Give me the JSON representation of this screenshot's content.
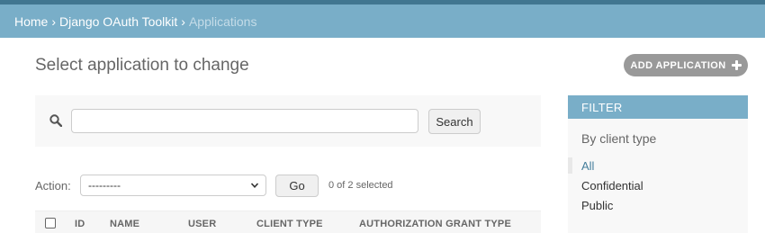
{
  "breadcrumbs": {
    "home": "Home",
    "app": "Django OAuth Toolkit",
    "current": "Applications",
    "separator": "›"
  },
  "page": {
    "title": "Select application to change",
    "add_button_label": "ADD APPLICATION"
  },
  "search": {
    "value": "",
    "button_label": "Search"
  },
  "actions": {
    "label": "Action:",
    "selected_option": "---------",
    "go_label": "Go",
    "selected_count": "0 of 2 selected"
  },
  "table": {
    "columns": [
      "ID",
      "NAME",
      "USER",
      "CLIENT TYPE",
      "AUTHORIZATION GRANT TYPE"
    ]
  },
  "filter": {
    "title": "FILTER",
    "subtitle": "By client type",
    "options": [
      "All",
      "Confidential",
      "Public"
    ],
    "selected": "All"
  },
  "colors": {
    "header_dark": "#417690",
    "header": "#79aec8",
    "link": "#447e9b",
    "add_button": "#999999"
  },
  "icons": [
    "search-icon",
    "plus-icon",
    "chevron-down-icon"
  ]
}
